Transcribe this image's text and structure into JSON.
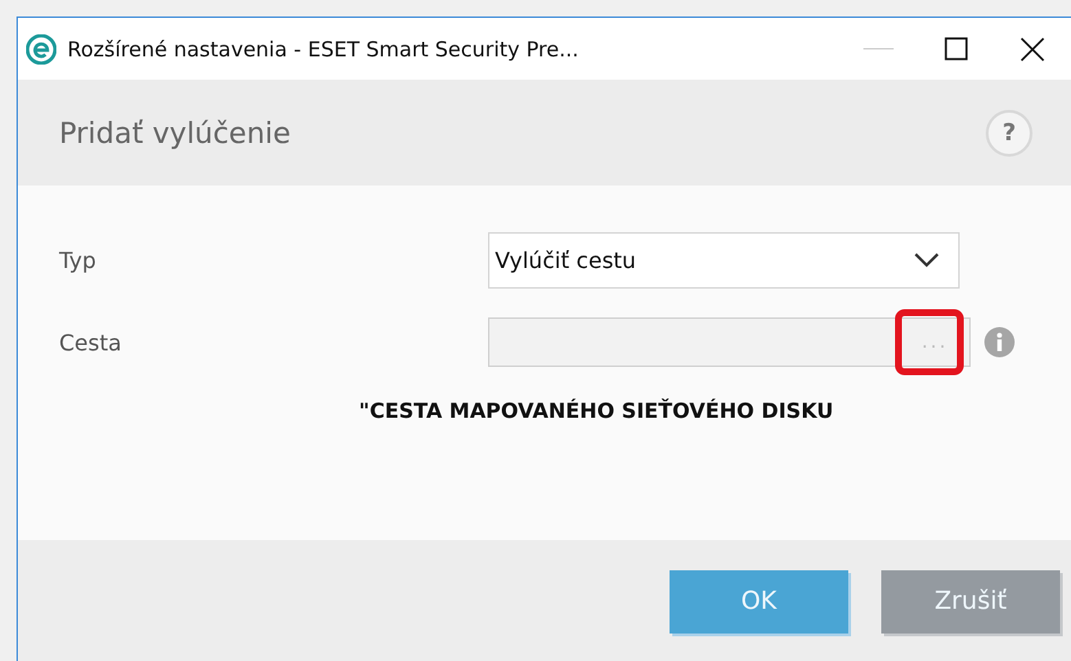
{
  "window": {
    "title": "Rozšírené nastavenia - ESET Smart Security Pre..."
  },
  "dialog": {
    "title": "Pridať vylúčenie",
    "help": "?"
  },
  "fields": [
    {
      "kind": "select",
      "label": "Typ",
      "value": "Vylúčiť cestu"
    },
    {
      "kind": "path",
      "label": "Cesta",
      "browse": "...",
      "highlighted": true
    }
  ],
  "caption": "\"CESTA MAPOVANÉHO SIEŤOVÉHO DISKU",
  "buttons": [
    {
      "label": "OK",
      "kind": "primary"
    },
    {
      "label": "Zrušiť",
      "kind": "secondary"
    }
  ]
}
